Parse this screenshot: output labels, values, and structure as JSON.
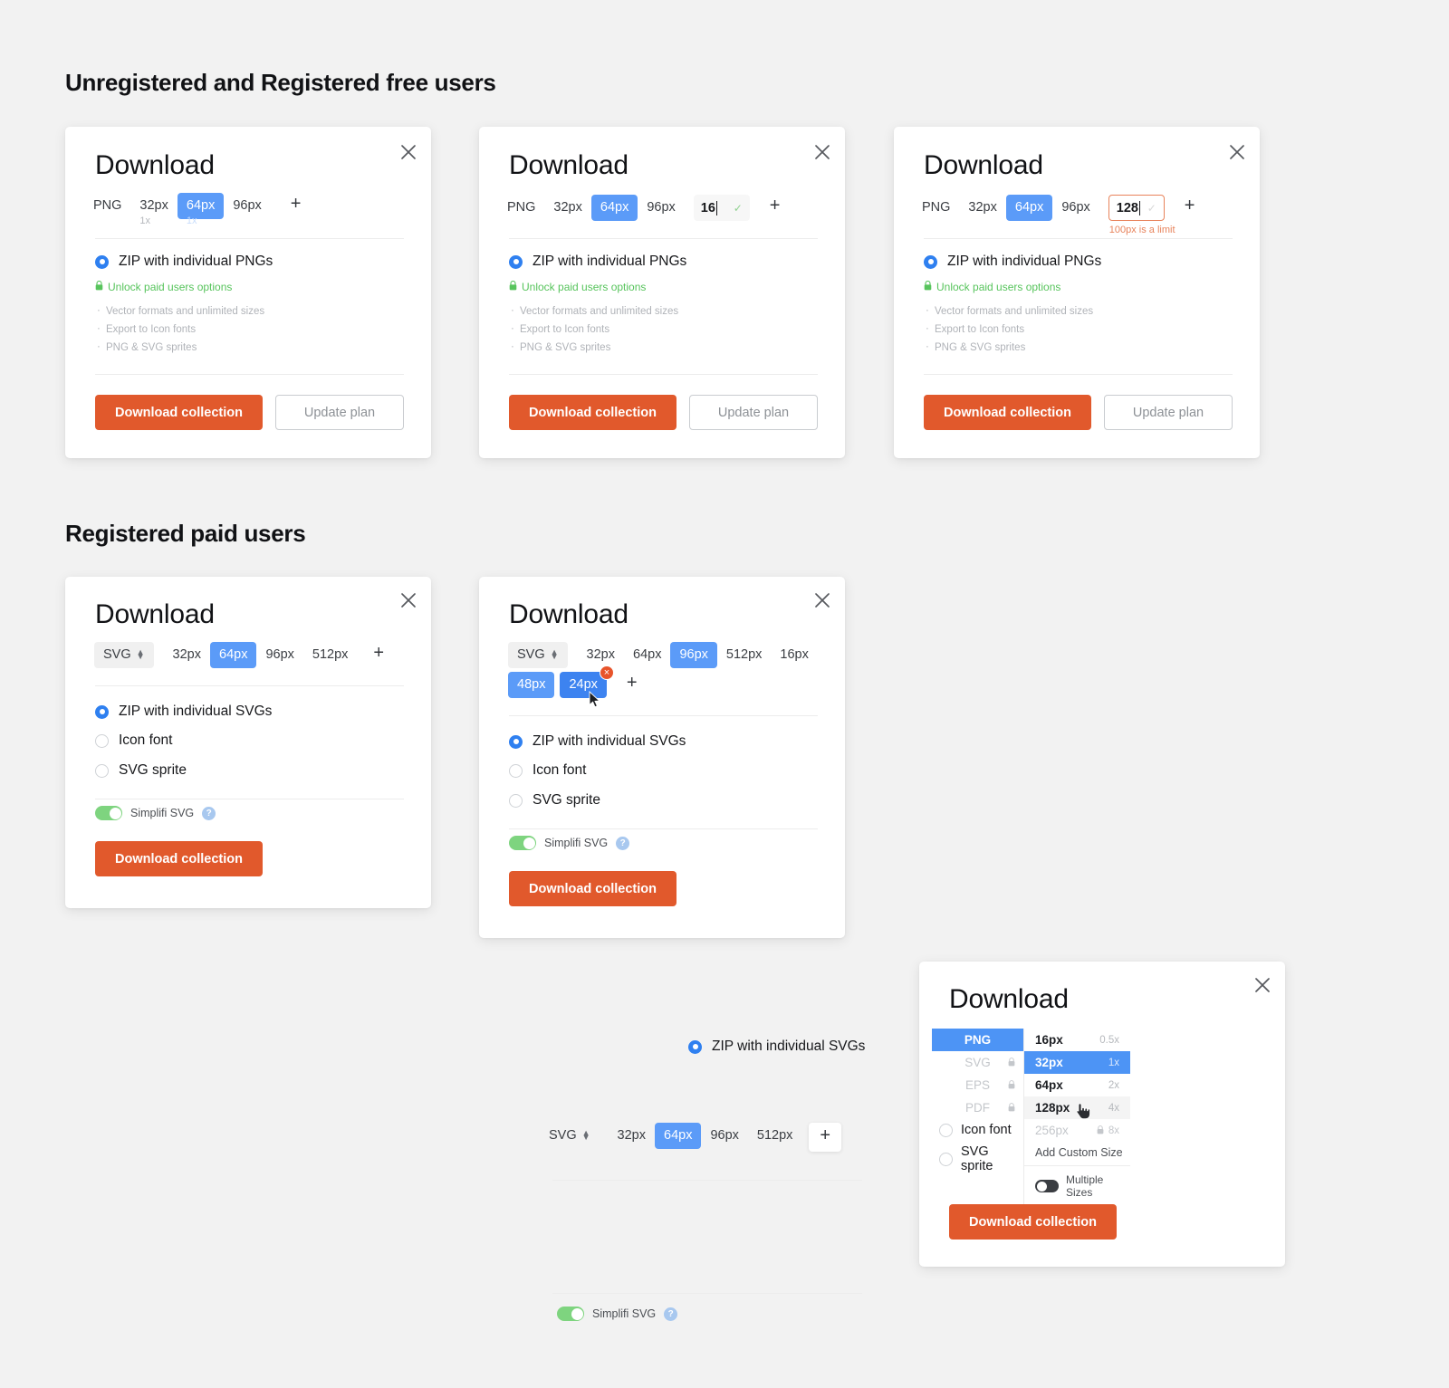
{
  "sections": {
    "free_heading": "Unregistered and Registered free users",
    "paid_heading": "Registered paid users"
  },
  "labels": {
    "title": "Download",
    "close_icon": "×",
    "plus": "+",
    "download_button": "Download collection",
    "update_plan_button": "Update plan",
    "simplifi_label": "Simplifi SVG",
    "help_icon": "?",
    "remove_badge": "×"
  },
  "upsell": {
    "link": "Unlock paid users options",
    "features": [
      "Vector formats and unlimited sizes",
      "Export to Icon fonts",
      "PNG & SVG sprites"
    ]
  },
  "card1": {
    "format": "PNG",
    "sizes": [
      {
        "label": "32px",
        "sub": "1x",
        "selected": false
      },
      {
        "label": "64px",
        "sub": "1x",
        "selected": true
      },
      {
        "label": "96px",
        "sub": "",
        "selected": false
      }
    ],
    "radio_label": "ZIP with individual PNGs"
  },
  "card2": {
    "format": "PNG",
    "sizes": [
      {
        "label": "32px",
        "selected": false
      },
      {
        "label": "64px",
        "selected": true
      },
      {
        "label": "96px",
        "selected": false
      }
    ],
    "input_value": "16",
    "input_state": "valid",
    "radio_label": "ZIP with individual PNGs"
  },
  "card3": {
    "format": "PNG",
    "sizes": [
      {
        "label": "32px",
        "selected": false
      },
      {
        "label": "64px",
        "selected": true
      },
      {
        "label": "96px",
        "selected": false
      }
    ],
    "input_value": "128",
    "input_state": "error",
    "error_message": "100px is a limit",
    "radio_label": "ZIP with individual PNGs"
  },
  "card4": {
    "format": "SVG",
    "sizes": [
      {
        "label": "32px",
        "selected": false
      },
      {
        "label": "64px",
        "selected": true
      },
      {
        "label": "96px",
        "selected": false
      },
      {
        "label": "512px",
        "selected": false
      }
    ],
    "options": [
      {
        "label": "ZIP with individual SVGs",
        "selected": true
      },
      {
        "label": "Icon font",
        "selected": false
      },
      {
        "label": "SVG sprite",
        "selected": false
      }
    ]
  },
  "card5": {
    "format": "SVG",
    "sizes_row1": [
      {
        "label": "32px",
        "selected": false
      },
      {
        "label": "64px",
        "selected": false
      },
      {
        "label": "96px",
        "selected": true
      },
      {
        "label": "512px",
        "selected": false
      },
      {
        "label": "16px",
        "selected": false
      }
    ],
    "sizes_row2": [
      {
        "label": "48px",
        "selected": true,
        "hover": false
      },
      {
        "label": "24px",
        "selected": true,
        "hover": true,
        "removable": true
      }
    ],
    "options": [
      {
        "label": "ZIP with individual SVGs",
        "selected": true
      },
      {
        "label": "Icon font",
        "selected": false
      },
      {
        "label": "SVG sprite",
        "selected": false
      }
    ]
  },
  "card6": {
    "title": "Download",
    "formats": [
      {
        "label": "PNG",
        "locked": false,
        "active": true
      },
      {
        "label": "SVG",
        "locked": true,
        "active": false
      },
      {
        "label": "EPS",
        "locked": true,
        "active": false
      },
      {
        "label": "PDF",
        "locked": true,
        "active": false
      }
    ],
    "radio_options": [
      {
        "label": "Icon font",
        "selected": false
      },
      {
        "label": "SVG sprite",
        "selected": false
      }
    ],
    "sizes": [
      {
        "label": "16px",
        "mult": "0.5x",
        "state": "normal"
      },
      {
        "label": "32px",
        "mult": "1x",
        "state": "active"
      },
      {
        "label": "64px",
        "mult": "2x",
        "state": "normal"
      },
      {
        "label": "128px",
        "mult": "4x",
        "state": "hover"
      },
      {
        "label": "256px",
        "mult": "8x",
        "state": "locked"
      }
    ],
    "add_custom_size": "Add Custom Size",
    "multiple_sizes": "Multiple Sizes",
    "download_button": "Download collection"
  },
  "loose": {
    "radio_label": "ZIP with individual SVGs",
    "format": "SVG",
    "sizes": [
      {
        "label": "32px",
        "selected": false
      },
      {
        "label": "64px",
        "selected": true
      },
      {
        "label": "96px",
        "selected": false
      },
      {
        "label": "512px",
        "selected": false
      }
    ],
    "plus": "+",
    "simplifi_label": "Simplifi SVG",
    "help_icon": "?"
  },
  "colors": {
    "background": "#f2f2f2",
    "card": "#ffffff",
    "accent_blue": "#5b9bf8",
    "accent_blue_dark": "#3d83f0",
    "primary_orange": "#e1592c",
    "error_orange": "#e8835b",
    "green": "#57c45c",
    "toggle_green": "#7ed47f",
    "text": "#17181b",
    "muted": "#b0b3b8"
  }
}
